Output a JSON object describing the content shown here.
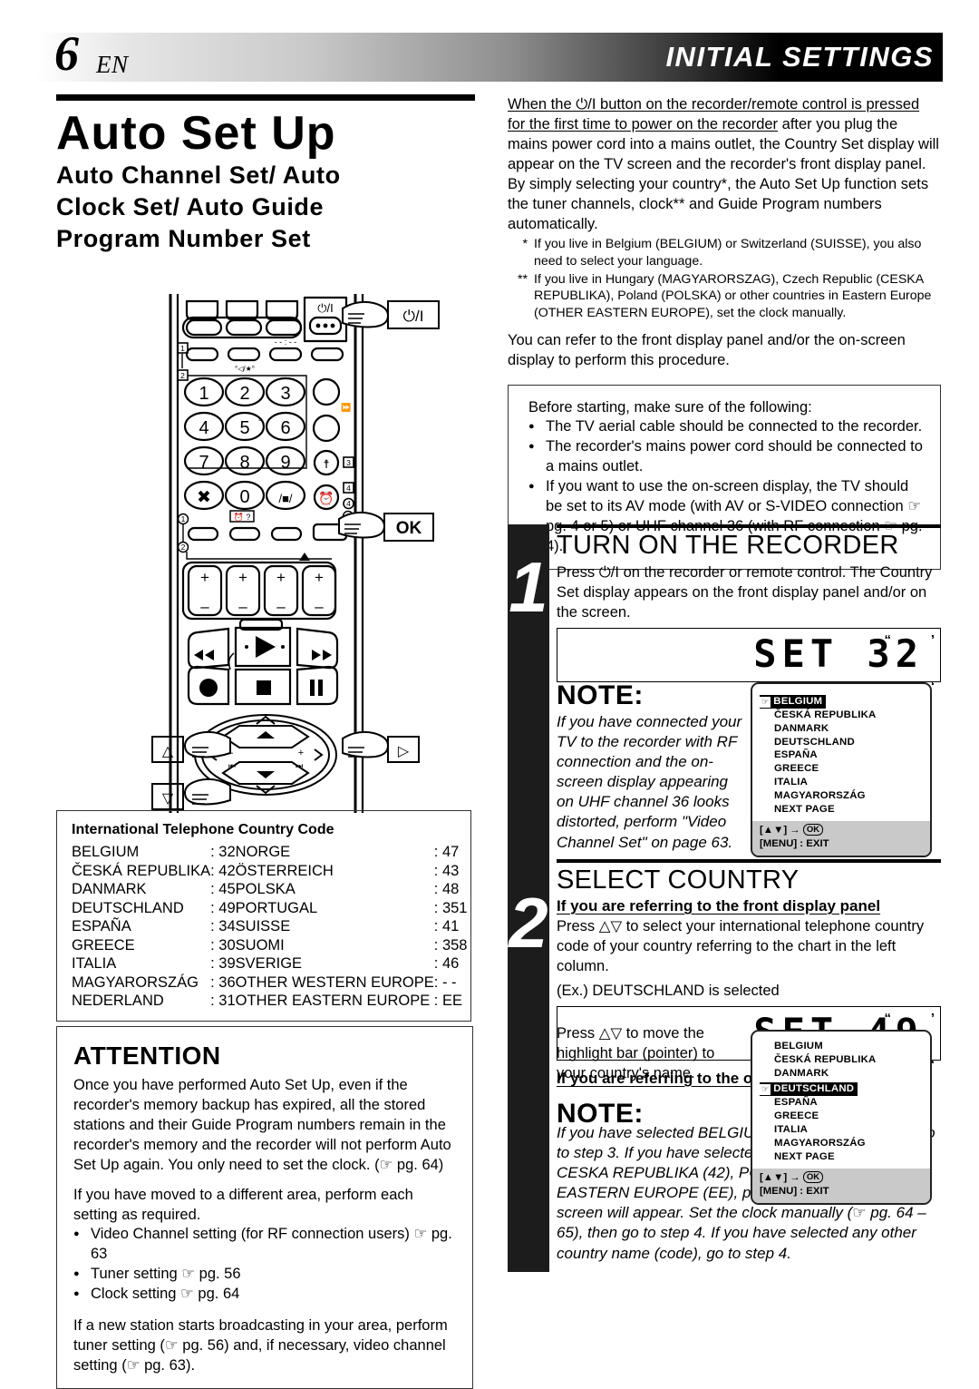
{
  "header": {
    "page_number": "6",
    "lang": "EN",
    "section_title": "INITIAL SETTINGS"
  },
  "left": {
    "title": "Auto Set Up",
    "subtitle_lines": [
      "Auto Channel Set/ Auto",
      "Clock Set/ Auto Guide",
      "Program Number Set"
    ],
    "code_table": {
      "title": "International Telephone Country Code",
      "rows": [
        {
          "name1": "BELGIUM",
          "code1": ": 32",
          "name2": "NORGE",
          "code2": ": 47"
        },
        {
          "name1": "ČESKÁ REPUBLIKA",
          "code1": ": 42",
          "name2": "ÖSTERREICH",
          "code2": ": 43"
        },
        {
          "name1": "DANMARK",
          "code1": ": 45",
          "name2": "POLSKA",
          "code2": ": 48"
        },
        {
          "name1": "DEUTSCHLAND",
          "code1": ": 49",
          "name2": "PORTUGAL",
          "code2": ": 351"
        },
        {
          "name1": "ESPAÑA",
          "code1": ": 34",
          "name2": "SUISSE",
          "code2": ": 41"
        },
        {
          "name1": "GREECE",
          "code1": ": 30",
          "name2": "SUOMI",
          "code2": ": 358"
        },
        {
          "name1": "ITALIA",
          "code1": ": 39",
          "name2": "SVERIGE",
          "code2": ": 46"
        },
        {
          "name1": "MAGYARORSZÁG",
          "code1": ": 36",
          "name2": "OTHER WESTERN EUROPE",
          "code2": ": - -"
        },
        {
          "name1": "NEDERLAND",
          "code1": ": 31",
          "name2": "OTHER EASTERN EUROPE",
          "code2": ": EE"
        }
      ]
    },
    "attention": {
      "heading": "ATTENTION",
      "para1": "Once you have performed Auto Set Up, even if the recorder's memory backup has expired, all the stored stations and their Guide Program numbers remain in the recorder's memory and the recorder will not perform Auto Set Up again. You only need to set the clock. (☞ pg. 64)",
      "para2": "If you have moved to a different area, perform each setting as required.",
      "bullets": [
        "Video Channel setting (for RF connection users) ☞ pg. 63",
        "Tuner setting ☞ pg. 56",
        "Clock setting ☞ pg. 64"
      ],
      "para3": "If a new station starts broadcasting in your area, perform tuner setting (☞ pg. 56) and, if necessary, video channel setting  (☞ pg. 63)."
    },
    "remote_labels": {
      "power": "⏻/I",
      "ok": "OK",
      "up": "△",
      "down": "▽",
      "right": "▷",
      "keys": [
        "1",
        "2",
        "3",
        "4",
        "5",
        "6",
        "7",
        "8",
        "9",
        "0"
      ],
      "callouts": [
        "1",
        "2",
        "3",
        "4"
      ]
    }
  },
  "right": {
    "intro_underlined": "When the ⏻/I button on the recorder/remote control is pressed for the first time to power on the recorder",
    "intro_rest": " after you plug the mains power cord into a mains outlet, the Country Set display will appear on the TV screen and the recorder's front display panel. By simply selecting your country*, the Auto Set Up function sets the tuner channels, clock** and Guide Program numbers automatically.",
    "footnotes": [
      {
        "mark": "*",
        "text": "If you live in Belgium (BELGIUM) or Switzerland (SUISSE), you also need to select your language."
      },
      {
        "mark": "**",
        "text": "If you live in Hungary (MAGYARORSZAG), Czech Republic (CESKA REPUBLIKA), Poland (POLSKA) or other countries in Eastern Europe (OTHER EASTERN EUROPE), set the clock manually."
      }
    ],
    "refer_para": "You can refer to the front display panel and/or the on-screen display to perform this procedure.",
    "before_box": {
      "lead": "Before starting, make sure of the following:",
      "bullets": [
        "The TV aerial cable should be connected to the recorder.",
        "The recorder's mains power cord should be connected to a mains outlet.",
        "If you want to use the on-screen display, the TV should be set to its AV mode (with AV or S-VIDEO connection ☞ pg. 4 or 5) or UHF channel 36 (with RF connection ☞ pg. 4)."
      ]
    },
    "step1": {
      "number": "1",
      "heading": "TURN ON THE RECORDER",
      "body": "Press ⏻/I on the recorder or remote control. The Country Set display appears on the front display panel and/or on the screen.",
      "lcd": "SET 32",
      "note_heading": "NOTE:",
      "note_body": "If you have connected your TV to the recorder with RF connection and the on-screen display appearing on UHF channel 36 looks distorted, perform \"Video Channel Set\" on page 63."
    },
    "step2": {
      "number": "2",
      "heading": "SELECT COUNTRY",
      "sub1": "If you are referring to the front display panel",
      "body1": "Press △▽ to select your international telephone country code of your country referring to the chart in the left column.",
      "example": "(Ex.) DEUTSCHLAND is selected",
      "lcd": "SET 49",
      "sub2": "If you are referring to the on-screen display",
      "body2": "Press △▽ to move the highlight bar (pointer) to your country's name.",
      "note_heading": "NOTE:",
      "note_body": "If you have selected BELGIUM (32) or SUISSE (41), go to step 3. If you have selected MAGYARORSZAG (36), CESKA REPUBLIKA (42), POLSKA (48) or OTHER EASTERN EUROPE (EE), press OK. The Clock Set screen will appear. Set the clock manually (☞ pg. 64 – 65), then go to step 4. If you have selected any other country name (code), go to step 4."
    },
    "tv_menu_1": {
      "items": [
        "BELGIUM",
        "ČESKÁ REPUBLIKA",
        "DANMARK",
        "DEUTSCHLAND",
        "ESPAÑA",
        "GREECE",
        "ITALIA",
        "MAGYARORSZÁG",
        "NEXT PAGE"
      ],
      "selected": "BELGIUM",
      "foot1_prefix": "[▲▼] → ",
      "foot1_ok": "OK",
      "foot2": "[MENU] : EXIT"
    },
    "tv_menu_2": {
      "items": [
        "BELGIUM",
        "ČESKÁ REPUBLIKA",
        "DANMARK",
        "DEUTSCHLAND",
        "ESPAÑA",
        "GREECE",
        "ITALIA",
        "MAGYARORSZÁG",
        "NEXT PAGE"
      ],
      "selected": "DEUTSCHLAND",
      "foot1_prefix": "[▲▼] → ",
      "foot1_ok": "OK",
      "foot2": "[MENU] : EXIT"
    }
  },
  "colors": {
    "ink": "#000000",
    "bar": "#1c1c1c",
    "menu_footer": "#c9c9c9"
  }
}
